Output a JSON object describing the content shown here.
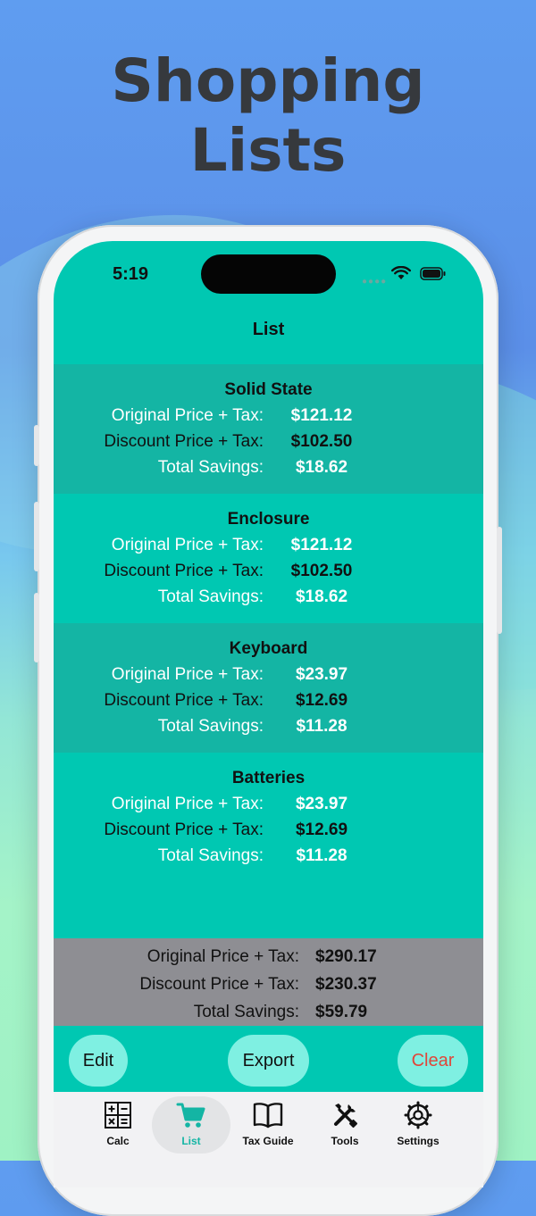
{
  "hero": {
    "line1": "Shopping",
    "line2": "Lists"
  },
  "status": {
    "time": "5:19"
  },
  "nav": {
    "title": "List"
  },
  "labels": {
    "original": "Original Price + Tax:",
    "discount": "Discount Price + Tax:",
    "savings": "Total Savings:"
  },
  "items": [
    {
      "name": "Solid State",
      "original": "$121.12",
      "discount": "$102.50",
      "savings": "$18.62"
    },
    {
      "name": "Enclosure",
      "original": "$121.12",
      "discount": "$102.50",
      "savings": "$18.62"
    },
    {
      "name": "Keyboard",
      "original": "$23.97",
      "discount": "$12.69",
      "savings": "$11.28"
    },
    {
      "name": "Batteries",
      "original": "$23.97",
      "discount": "$12.69",
      "savings": "$11.28"
    }
  ],
  "totals": {
    "original": "$290.17",
    "discount": "$230.37",
    "savings": "$59.79"
  },
  "actions": {
    "edit": "Edit",
    "export": "Export",
    "clear": "Clear"
  },
  "tabs": [
    {
      "label": "Calc",
      "icon": "calculator-icon"
    },
    {
      "label": "List",
      "icon": "cart-icon"
    },
    {
      "label": "Tax Guide",
      "icon": "book-icon"
    },
    {
      "label": "Tools",
      "icon": "tools-icon"
    },
    {
      "label": "Settings",
      "icon": "gear-icon"
    }
  ],
  "colors": {
    "screen_bg": "#00c8b2",
    "row_alt_bg": "#14b5a4",
    "totals_bg": "#8e8e93",
    "pill_bg": "#7ff0e2",
    "clear_text": "#e0463a",
    "active_tab": "#14b5a4"
  }
}
